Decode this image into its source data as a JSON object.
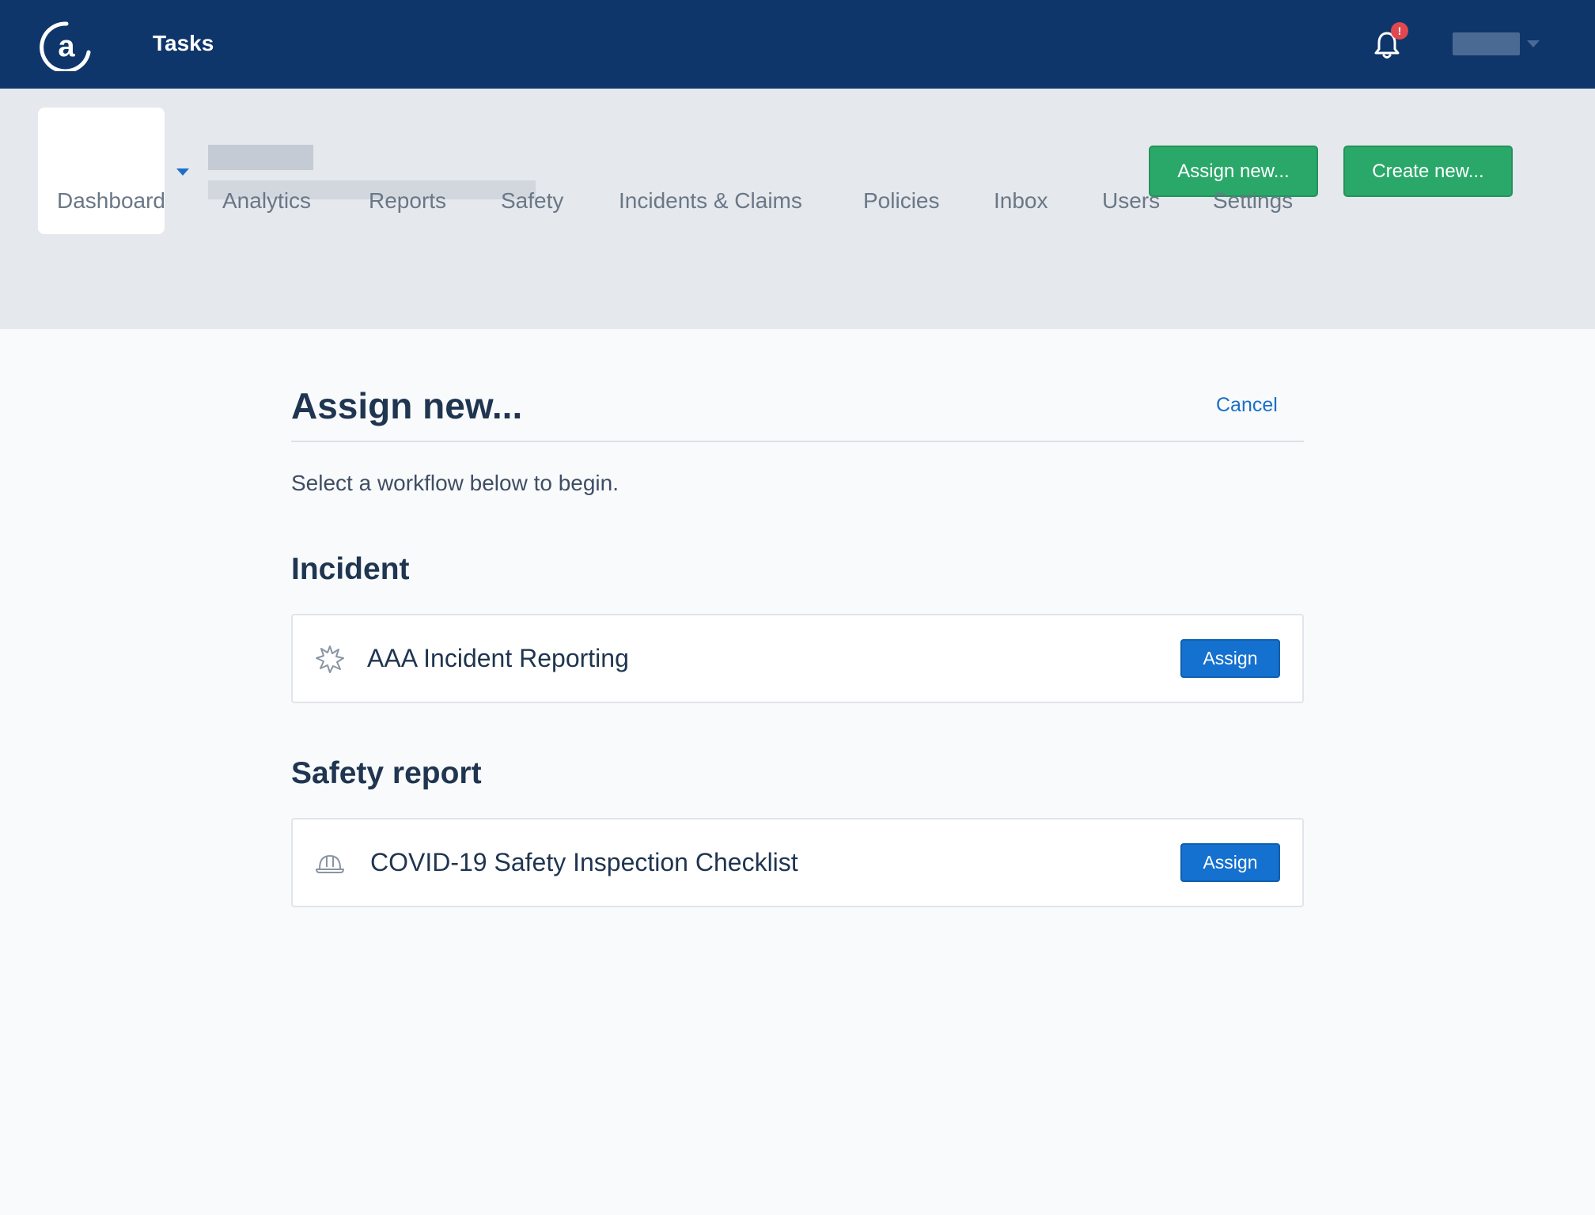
{
  "topbar": {
    "app_title": "Tasks",
    "logo_icon": "at-sign-logo",
    "notification_badge": "!",
    "bell_icon": "bell-icon"
  },
  "header_actions": {
    "assign_new_label": "Assign new...",
    "create_new_label": "Create new..."
  },
  "nav": {
    "items": [
      {
        "label": "Dashboard"
      },
      {
        "label": "Analytics"
      },
      {
        "label": "Reports"
      },
      {
        "label": "Safety"
      },
      {
        "label": "Incidents & Claims"
      },
      {
        "label": "Policies"
      },
      {
        "label": "Inbox"
      },
      {
        "label": "Users"
      },
      {
        "label": "Settings"
      }
    ]
  },
  "main": {
    "title": "Assign new...",
    "cancel_label": "Cancel",
    "intro": "Select a workflow below to begin.",
    "sections": [
      {
        "heading": "Incident",
        "workflows": [
          {
            "name": "AAA Incident Reporting",
            "icon": "burst-icon",
            "action_label": "Assign"
          }
        ]
      },
      {
        "heading": "Safety report",
        "workflows": [
          {
            "name": "COVID-19 Safety Inspection Checklist",
            "icon": "hard-hat-icon",
            "action_label": "Assign"
          }
        ]
      }
    ]
  },
  "colors": {
    "topbar_bg": "#0e366b",
    "header_bg": "#e5e8ec",
    "green_button": "#2aa86a",
    "blue_button": "#1471cf",
    "link": "#1a6fc4",
    "badge": "#e0484f"
  }
}
